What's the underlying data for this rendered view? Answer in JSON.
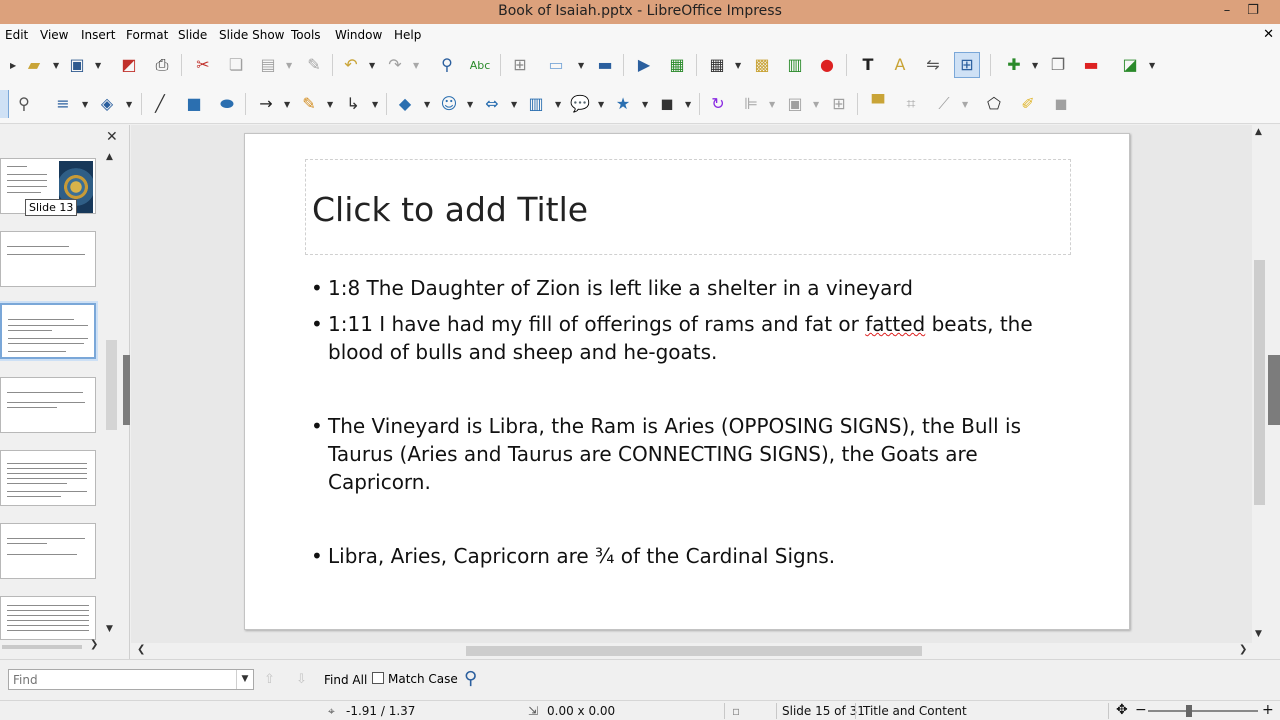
{
  "window": {
    "title": "Book of Isaiah.pptx - LibreOffice Impress",
    "minimize": "–",
    "restore": "❐"
  },
  "menu": {
    "items": [
      "Edit",
      "View",
      "Insert",
      "Format",
      "Slide",
      "Slide Show",
      "Tools",
      "Window",
      "Help"
    ],
    "close": "✕"
  },
  "slide_panel": {
    "close": "✕",
    "tooltip": "Slide 13",
    "scroll_up": "▲",
    "scroll_down": "▼",
    "scroll_right": "❯"
  },
  "slide": {
    "title_placeholder": "Click to add Title",
    "bullet_char": "•",
    "bullets": [
      "1:8 The Daughter of Zion is left like a shelter in a vineyard",
      "I have had my fill of offerings of rams and fat or",
      "The Vineyard is Libra, the Ram is Aries (OPPOSING SIGNS), the Bull is Taurus (Aries and Taurus are CONNECTING SIGNS), the Goats are Capricorn.",
      "Libra, Aries, Capricorn are ¾ of the Cardinal Signs."
    ],
    "bullet2_prefix": "1:11",
    "bullet2_misspelled": "fatted",
    "bullet2_suffix": "beats, the blood of bulls and sheep and he-goats."
  },
  "scrollbars": {
    "up": "▲",
    "down": "▼",
    "left": "❮",
    "right": "❯"
  },
  "find_bar": {
    "placeholder": "Find",
    "dropdown": "▼",
    "prev": "⇧",
    "next": "⇩",
    "find_all": "Find All",
    "match_case": "Match Case"
  },
  "status_bar": {
    "position": "-1.91 / 1.37",
    "size": "0.00 x 0.00",
    "slide_count": "Slide 15 of 31",
    "layout": "Title and Content",
    "zoom_minus": "−",
    "zoom_plus": "+"
  },
  "icons": {
    "tb1": [
      "open-icon",
      "save-icon",
      "export-pdf-icon",
      "print-icon",
      "cut-icon",
      "copy-icon",
      "paste-icon",
      "clone-formatting-icon",
      "undo-icon",
      "redo-icon",
      "find-replace-icon",
      "spelling-icon",
      "grid-icon",
      "display-views-icon",
      "master-slide-icon",
      "start-slideshow-icon",
      "slide-layout-icon",
      "table-icon",
      "image-icon",
      "chart-icon",
      "record-icon",
      "text-box-icon",
      "fontwork-icon",
      "transformations-icon",
      "helplines-icon",
      "new-slide-icon",
      "duplicate-slide-icon",
      "delete-slide-icon",
      "slide-layout2-icon"
    ],
    "tb2": [
      "zoom-icon",
      "line-color-icon",
      "fill-color-icon",
      "line-icon",
      "rectangle-icon",
      "ellipse-icon",
      "arrow-line-icon",
      "curve-icon",
      "connector-icon",
      "basic-shapes-icon",
      "symbol-shapes-icon",
      "block-arrows-icon",
      "flowchart-icon",
      "callouts-icon",
      "stars-icon",
      "3d-objects-icon",
      "rotate-icon",
      "align-icon",
      "arrange-icon",
      "distribute-icon",
      "shadow-icon",
      "crop-icon",
      "filter-icon",
      "points-icon",
      "glue-points-icon",
      "toggle-extrusion-icon"
    ]
  },
  "colors": {
    "titlebar": "#dca17c",
    "accent": "#2b5f9e",
    "selection": "#7aa7d8"
  }
}
